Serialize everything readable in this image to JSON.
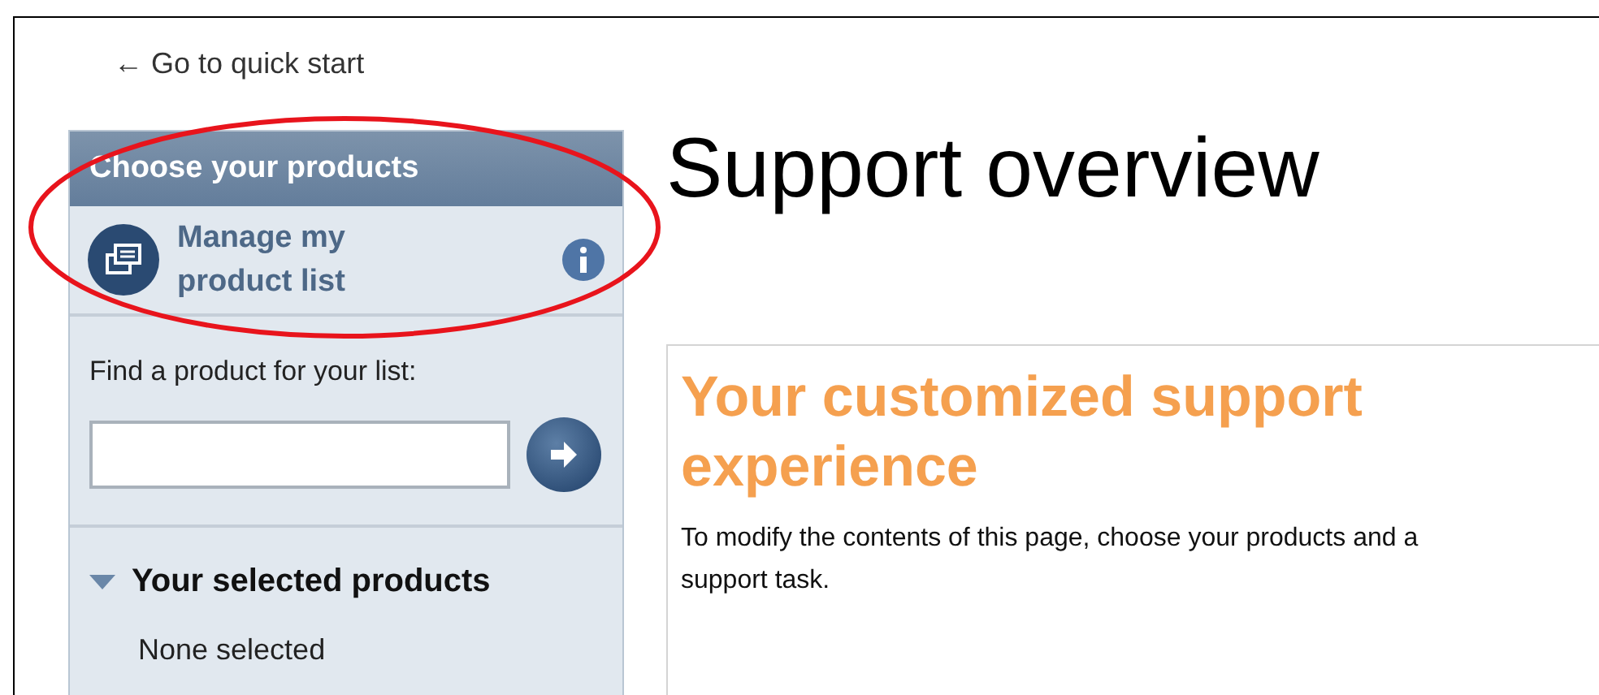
{
  "back_link": {
    "arrow": "←",
    "label": "Go to quick start"
  },
  "sidebar": {
    "title": "Choose your products",
    "manage": {
      "label": "Manage my product list"
    },
    "find": {
      "label": "Find a product for your list:"
    },
    "selected_section": {
      "title": "Your selected products",
      "expanded": true,
      "empty_text": "None selected"
    }
  },
  "page_title": "Support overview",
  "card": {
    "heading": "Your customized support experience",
    "text": "To modify the contents of this page, choose your products and a support task."
  },
  "annotation": {
    "kind": "ellipse",
    "color": "#e8141c"
  }
}
